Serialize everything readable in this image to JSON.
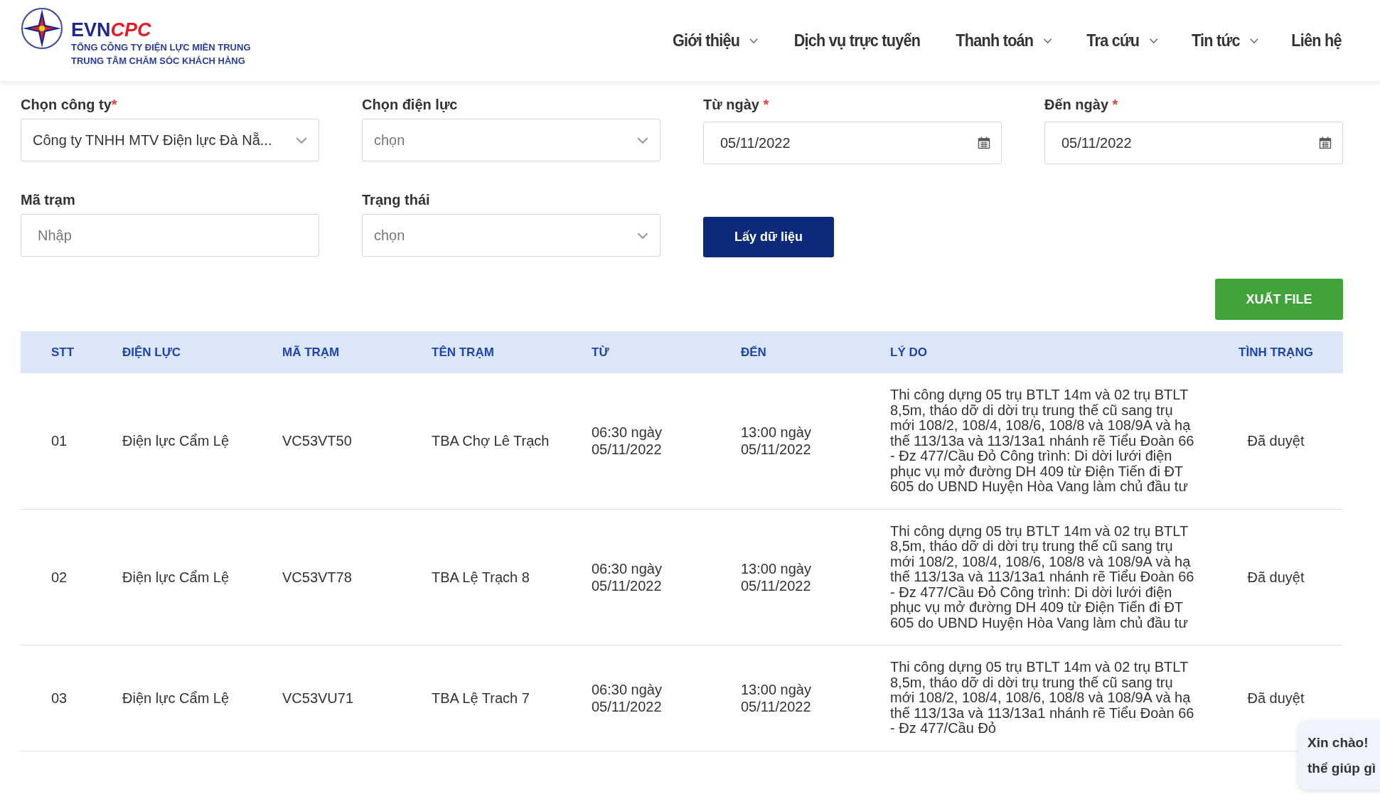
{
  "header": {
    "logo": {
      "brand_a": "EVN",
      "brand_b": "CPC",
      "line_1": "TỔNG CÔNG TY ĐIỆN LỰC MIỀN TRUNG",
      "line_2": "TRUNG TÂM CHĂM SÓC KHÁCH HÀNG"
    },
    "nav": [
      {
        "label": "Giới thiệu",
        "has_dropdown": true
      },
      {
        "label": "Dịch vụ trực tuyến",
        "has_dropdown": false
      },
      {
        "label": "Thanh toán",
        "has_dropdown": true
      },
      {
        "label": "Tra cứu",
        "has_dropdown": true
      },
      {
        "label": "Tin tức",
        "has_dropdown": true
      },
      {
        "label": "Liên hệ",
        "has_dropdown": false
      }
    ]
  },
  "filters": [
    {
      "kind": "select",
      "label": "Chọn công ty",
      "required_mark": "*",
      "tight": true,
      "value": "Công ty TNHH MTV Điện lực Đà Nẵ..."
    },
    {
      "kind": "select",
      "label": "Chọn điện lực",
      "placeholder": "chọn"
    },
    {
      "kind": "date",
      "label": "Từ ngày",
      "required_mark": "*",
      "tight": false,
      "value": "05/11/2022"
    },
    {
      "kind": "date",
      "label": "Đến ngày",
      "required_mark": "*",
      "tight": false,
      "value": "05/11/2022"
    },
    {
      "kind": "text",
      "label": "Mã trạm",
      "placeholder": "Nhập"
    },
    {
      "kind": "select",
      "label": "Trạng thái",
      "placeholder": "chọn"
    },
    {
      "kind": "button",
      "label": "Lấy dữ liệu"
    }
  ],
  "export_button": "XUẤT FILE",
  "table": {
    "columns": [
      "STT",
      "ĐIỆN LỰC",
      "MÃ TRẠM",
      "TÊN TRẠM",
      "TỪ",
      "ĐẾN",
      "LÝ DO",
      "TÌNH TRẠNG"
    ],
    "rows": [
      [
        "01",
        "Điện lực Cẩm Lệ",
        "VC53VT50",
        "TBA Chợ Lê Trạch",
        "06:30 ngày 05/11/2022",
        "13:00 ngày 05/11/2022",
        "Thi công dựng 05 trụ BTLT 14m và 02 trụ BTLT 8,5m, tháo dỡ di dời trụ trung thế cũ sang trụ mới 108/2, 108/4, 108/6, 108/8 và 108/9A và hạ thế 113/13a và 113/13a1 nhánh rẽ Tiểu Đoàn 66 - Đz 477/Cầu Đỏ Công trình: Di dời lưới điện phục vụ mở đường DH 409 từ Điện Tiến đi ĐT 605 do UBND Huyện Hòa Vang làm chủ đầu tư",
        "Đã duyệt"
      ],
      [
        "02",
        "Điện lực Cẩm Lệ",
        "VC53VT78",
        "TBA Lệ Trạch 8",
        "06:30 ngày 05/11/2022",
        "13:00 ngày 05/11/2022",
        "Thi công dựng 05 trụ BTLT 14m và 02 trụ BTLT 8,5m, tháo dỡ di dời trụ trung thế cũ sang trụ mới 108/2, 108/4, 108/6, 108/8 và 108/9A và hạ thế 113/13a và 113/13a1 nhánh rẽ Tiểu Đoàn 66 - Đz 477/Cầu Đỏ Công trình: Di dời lưới điện phục vụ mở đường DH 409 từ Điện Tiến đi ĐT 605 do UBND Huyện Hòa Vang làm chủ đầu tư",
        "Đã duyệt"
      ],
      [
        "03",
        "Điện lực Cẩm Lệ",
        "VC53VU71",
        "TBA Lệ Trach 7",
        "06:30 ngày 05/11/2022",
        "13:00 ngày 05/11/2022",
        "Thi công dựng 05 trụ BTLT 14m và 02 trụ BTLT 8,5m, tháo dỡ di dời trụ trung thế cũ sang trụ mới 108/2, 108/4, 108/6, 108/8 và 108/9A và hạ thế 113/13a và 113/13a1 nhánh rẽ Tiểu Đoàn 66 - Đz 477/Cầu Đỏ",
        "Đã duyệt"
      ]
    ]
  },
  "chat_bubble": [
    "Xin chào!",
    "thể giúp gì"
  ]
}
